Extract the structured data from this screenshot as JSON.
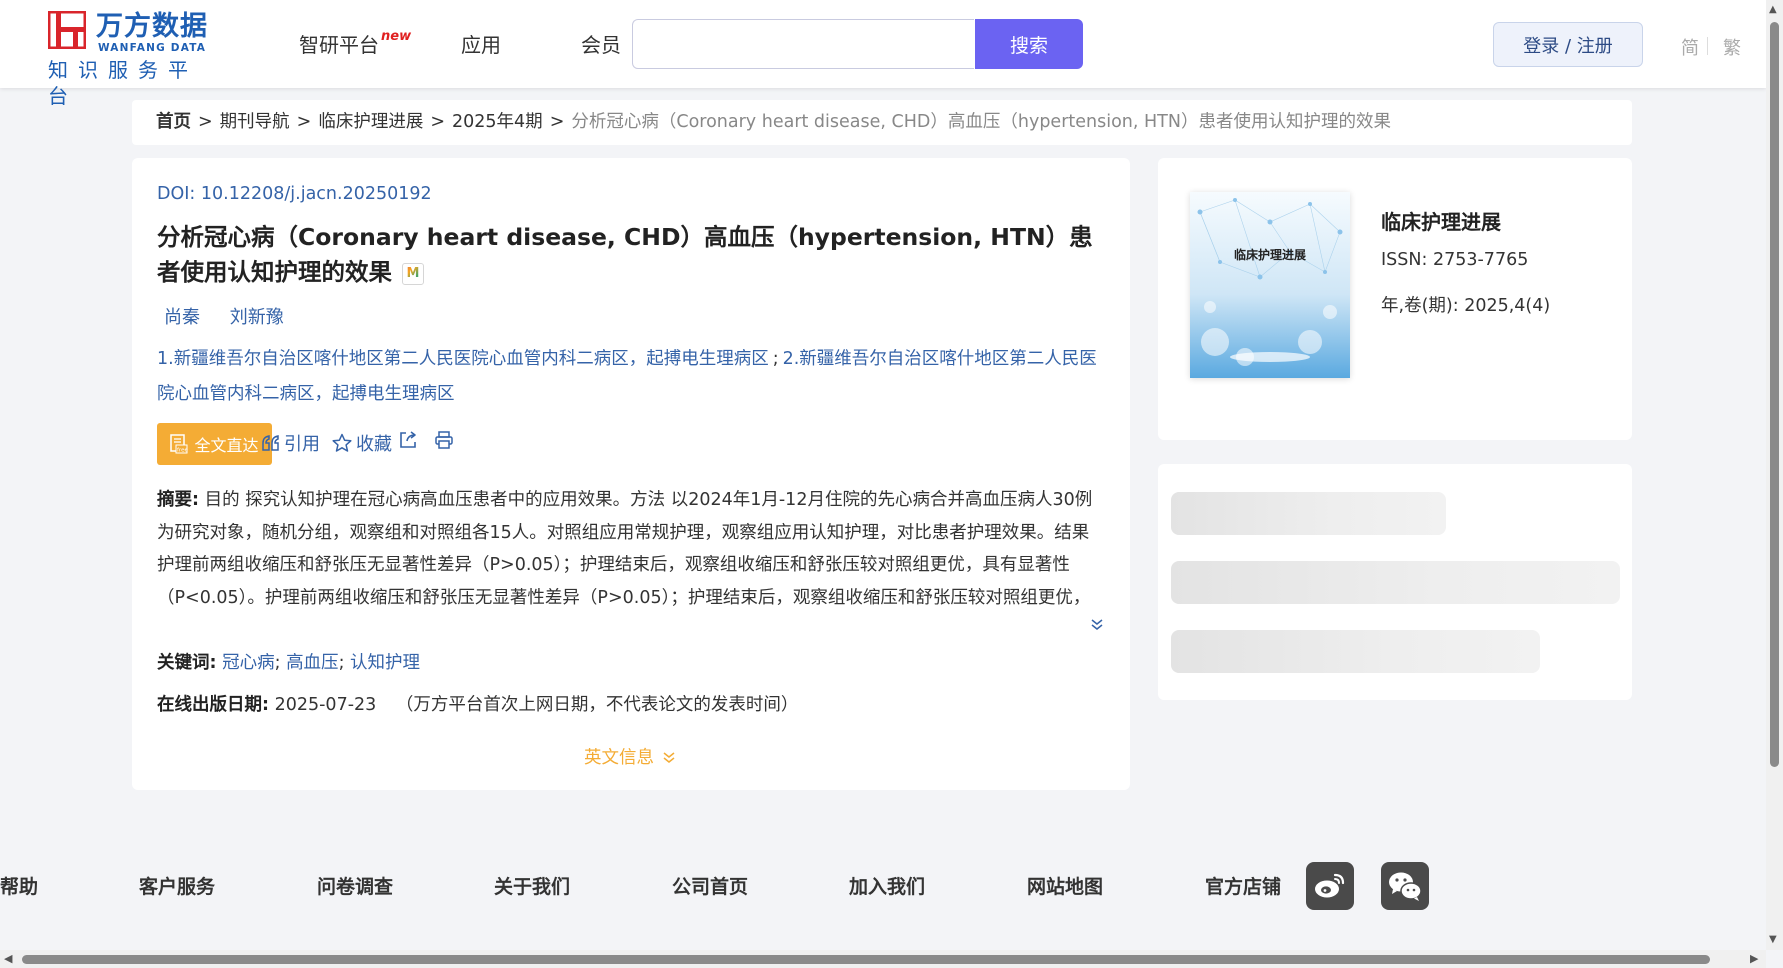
{
  "header": {
    "logo": {
      "cn": "万方数据",
      "en": "WANFANG DATA",
      "sub": "知识服务平台"
    },
    "nav": [
      {
        "label": "智研平台",
        "badge": "new"
      },
      {
        "label": "应用"
      },
      {
        "label": "会员"
      }
    ],
    "search": {
      "value": "",
      "button": "搜索"
    },
    "login": "登录 / 注册",
    "lang": {
      "simplified": "简",
      "traditional": "繁"
    }
  },
  "breadcrumb": {
    "items": [
      "首页",
      "期刊导航",
      "临床护理进展",
      "2025年4期"
    ],
    "separator": ">",
    "current": "分析冠心病（Coronary heart disease, CHD）高血压（hypertension, HTN）患者使用认知护理的效果"
  },
  "article": {
    "doi_label": "DOI:",
    "doi": "10.12208/j.jacn.20250192",
    "title": "分析冠心病（Coronary heart disease, CHD）高血压（hypertension, HTN）患者使用认知护理的效果",
    "authors": [
      "尚秦",
      "刘新豫"
    ],
    "affiliations": [
      "1.新疆维吾尔自治区喀什地区第二人民医院心血管内科二病区，起搏电生理病区",
      "2.新疆维吾尔自治区喀什地区第二人民医院心血管内科二病区，起搏电生理病区"
    ],
    "affil_sep": ";",
    "actions": {
      "fulltext": "全文直达",
      "cite": "引用",
      "favorite": "收藏"
    },
    "abstract_label": "摘要:",
    "abstract": "目的 探究认知护理在冠心病高血压患者中的应用效果。方法 以2024年1月-12月住院的先心病合并高血压病人30例为研究对象，随机分组，观察组和对照组各15人。对照组应用常规护理，观察组应用认知护理，对比患者护理效果。结果 护理前两组收缩压和舒张压无显著性差异（P>0.05）；护理结束后，观察组收缩压和舒张压较对照组更优，具有显著性（P<0.05）。护理前两组收缩压和舒张压无显著性差异（P>0.05）；护理结束后，观察组收缩压和舒张压较对照组更优，具有显著性（P<0.05）。结论 认知护理能有效地控制冠心病合并高血压病人的血压，改善他们的生活质量，改善他们的心...",
    "keywords_label": "关键词:",
    "keywords": [
      "冠心病",
      "高血压",
      "认知护理"
    ],
    "keyword_sep": ";",
    "pubdate_label": "在线出版日期:",
    "pubdate": "2025-07-23",
    "pubdate_note": "（万方平台首次上网日期，不代表论文的发表时间）",
    "english_info": "英文信息"
  },
  "journal": {
    "cover_title": "临床护理进展",
    "name": "临床护理进展",
    "issn_label": "ISSN:",
    "issn": "2753-7765",
    "volume_label": "年,卷(期):",
    "volume": "2025,4(4)"
  },
  "footer": {
    "links": [
      "帮助",
      "客户服务",
      "问卷调查",
      "关于我们",
      "公司首页",
      "加入我们",
      "网站地图",
      "官方店铺"
    ],
    "social": [
      "weibo-icon",
      "wechat-icon"
    ]
  },
  "colors": {
    "accent": "#6b63f2",
    "link": "#3563a8",
    "orange": "#f4ac35",
    "brand": "#1f5fb3",
    "logo_red": "#d9252b"
  }
}
